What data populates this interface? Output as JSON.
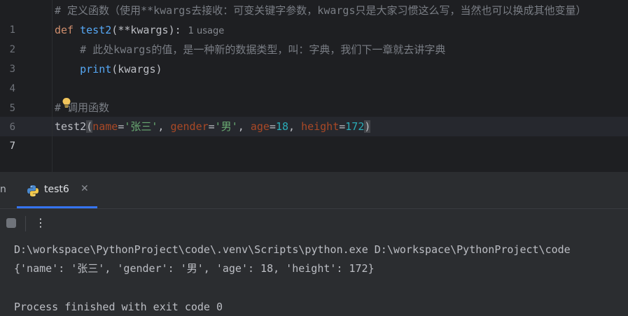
{
  "editor": {
    "lines": [
      {
        "num": "1",
        "comment": "# 定义函数（使用**kwargs去接收：可变关键字参数，kwargs只是大家习惯这么写，当然也可以换成其他变量）"
      },
      {
        "num": "2",
        "kw": "def",
        "fname": "test2",
        "open": "(",
        "stars": "**",
        "param": "kwargs",
        "close": "):",
        "hint": "1 usage"
      },
      {
        "num": "3",
        "comment": "# 此处kwargs的值，是一种新的数据类型，叫：字典，我们下一章就去讲字典"
      },
      {
        "num": "4",
        "builtin": "print",
        "args": "(kwargs)"
      },
      {
        "num": "5"
      },
      {
        "num": "6",
        "comment": "# 调用函数"
      },
      {
        "num": "7",
        "call": "test2",
        "p1": "name",
        "v1": "'张三'",
        "p2": "gender",
        "v2": "'男'",
        "p3": "age",
        "v3": "18",
        "p4": "height",
        "v4": "172"
      }
    ]
  },
  "run_panel": {
    "cut_tab_label": "n",
    "tab_label": "test6",
    "tab_icon": "python-icon",
    "close_glyph": "✕",
    "more_glyph": "⋮",
    "stop_icon": "stop-icon"
  },
  "console": {
    "lines": [
      "D:\\workspace\\PythonProject\\code\\.venv\\Scripts\\python.exe D:\\workspace\\PythonProject\\code",
      "{'name': '张三', 'gender': '男', 'age': 18, 'height': 172}",
      "",
      "Process finished with exit code 0"
    ]
  },
  "colors": {
    "background": "#1e1f22",
    "panel": "#2b2d30",
    "accent": "#3574f0",
    "comment": "#7a7e85",
    "keyword": "#cf8e6d",
    "function": "#56a8f5",
    "string": "#6aab73",
    "number": "#2aacb8",
    "param": "#aa4926"
  }
}
